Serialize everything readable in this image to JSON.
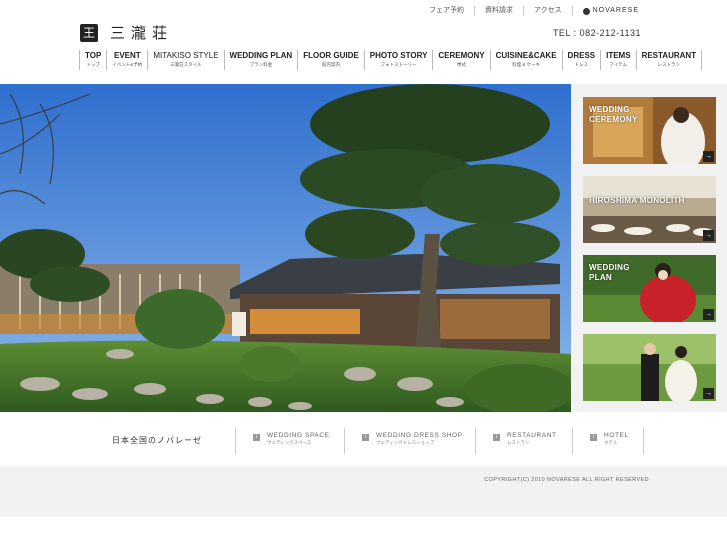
{
  "header": {
    "logo_mark": "王",
    "logo_text": "三瀧荘",
    "tel": "TEL : 082-212-1131"
  },
  "top_nav": [
    {
      "label": "フェア予約"
    },
    {
      "label": "資料請求"
    },
    {
      "label": "アクセス"
    }
  ],
  "brand": "NOVARESE",
  "global_nav": [
    {
      "en": "TOP",
      "jp": "トップ"
    },
    {
      "en": "EVENT",
      "jp": "イベント&予約"
    },
    {
      "en": "MITAKISO STYLE",
      "jp": "三瀧荘スタイル"
    },
    {
      "en": "WEDDING PLAN",
      "jp": "プラン料金"
    },
    {
      "en": "FLOOR GUIDE",
      "jp": "館内案内"
    },
    {
      "en": "PHOTO STORY",
      "jp": "フォトストーリー"
    },
    {
      "en": "CEREMONY",
      "jp": "挙式"
    },
    {
      "en": "CUISINE&CAKE",
      "jp": "料理 & ケーキ"
    },
    {
      "en": "DRESS",
      "jp": "ドレス"
    },
    {
      "en": "ITEMS",
      "jp": "アイテム"
    },
    {
      "en": "RESTAURANT",
      "jp": "レストラン"
    }
  ],
  "side_cards": [
    {
      "label_line1": "WEDDING",
      "label_line2": "CEREMONY",
      "arrow": "→"
    },
    {
      "label_line1": "HIROSHIMA MONOLITH",
      "label_line2": "",
      "arrow": "→"
    },
    {
      "label_line1": "WEDDING",
      "label_line2": "PLAN",
      "arrow": "→"
    },
    {
      "label_line1": "",
      "label_line2": "",
      "arrow": "→"
    }
  ],
  "bottom_nav": {
    "tagline": "日本全国のノバレーゼ",
    "items": [
      {
        "en": "WEDDING SPACE",
        "jp": "ウェディングスペース",
        "icon": "i"
      },
      {
        "en": "WEDDING DRESS SHOP",
        "jp": "ウェディングドレスショップ",
        "icon": "i"
      },
      {
        "en": "RESTAURANT",
        "jp": "レストラン",
        "icon": "i"
      },
      {
        "en": "HOTEL",
        "jp": "ホテル",
        "icon": "i"
      }
    ]
  },
  "footer": {
    "copyright": "COPYRIGHT(C) 2010 NOVARESE ALL RIGHT RESERVED"
  },
  "colors": {
    "sky": "#3f7fd6",
    "pine": "#2c4a24",
    "lawn": "#4f7d2f",
    "panel_bg": "#f2f2f2",
    "text": "#333333"
  }
}
